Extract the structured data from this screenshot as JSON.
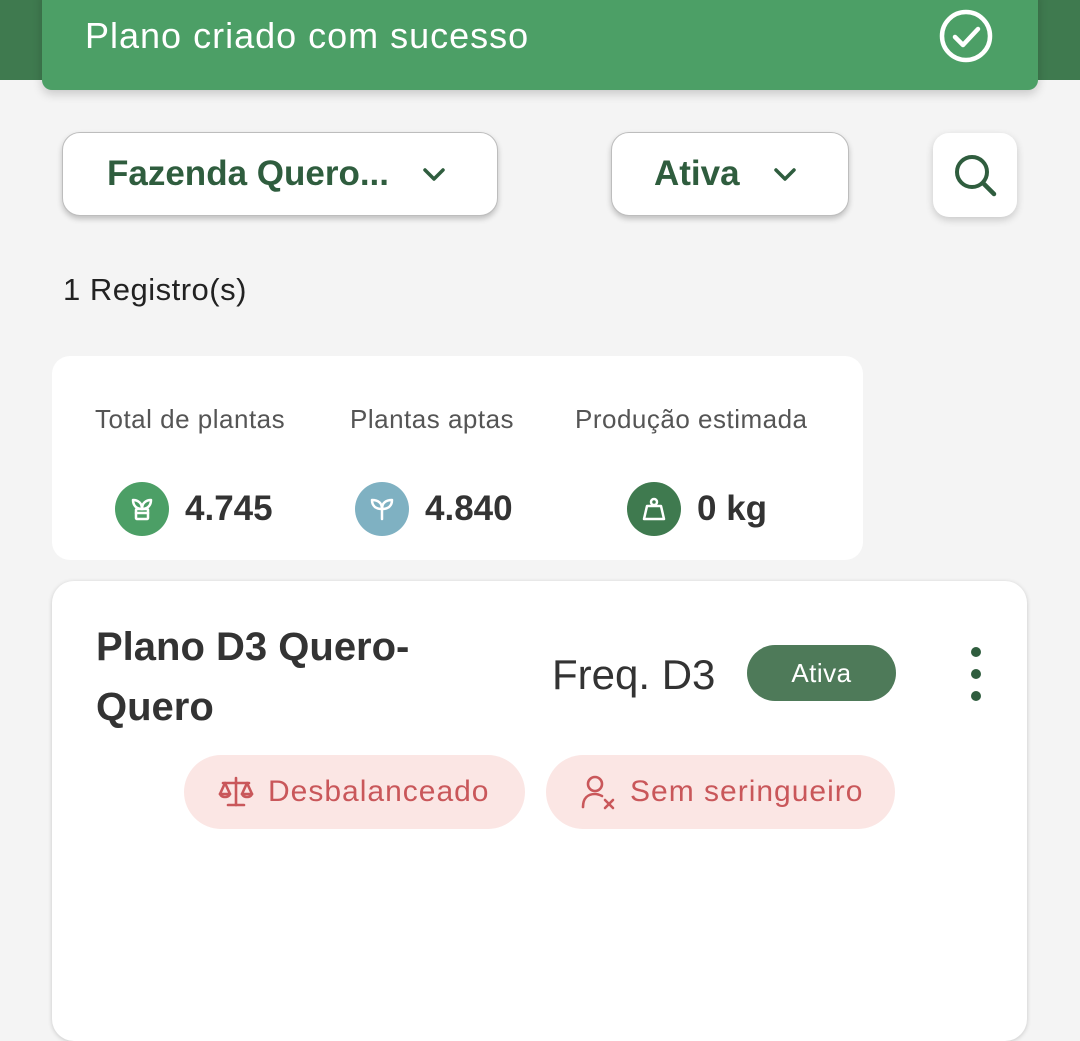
{
  "toast": {
    "message": "Plano criado com sucesso",
    "icon": "check-circle-icon"
  },
  "filters": {
    "farm": {
      "selected": "Fazenda Quero...",
      "icon": "chevron-down-icon"
    },
    "status": {
      "selected": "Ativa",
      "icon": "chevron-down-icon"
    },
    "search_icon": "search-icon"
  },
  "records": {
    "label": "1 Registro(s)"
  },
  "summary": {
    "total_plants": {
      "label": "Total de plantas",
      "value": "4.745",
      "icon": "plant-pot-icon",
      "color": "#4c9f66"
    },
    "fit_plants": {
      "label": "Plantas aptas",
      "value": "4.840",
      "icon": "sprout-icon",
      "color": "#7fb1c2"
    },
    "estimated_production": {
      "label": "Produção estimada",
      "value": "0 kg",
      "icon": "weight-icon",
      "color": "#3f7a4f"
    }
  },
  "plan": {
    "title": "Plano D3 Quero-Quero",
    "frequency": "Freq. D3",
    "status": "Ativa",
    "menu_icon": "more-vertical-icon",
    "tags": [
      {
        "label": "Desbalanceado",
        "icon": "scale-icon"
      },
      {
        "label": "Sem seringueiro",
        "icon": "user-x-icon"
      }
    ]
  },
  "colors": {
    "primary": "#3f7a4f",
    "toast": "#4c9f66",
    "text_green": "#2f5d3e",
    "tag_bg": "#fbe6e4",
    "tag_text": "#c9575a"
  }
}
